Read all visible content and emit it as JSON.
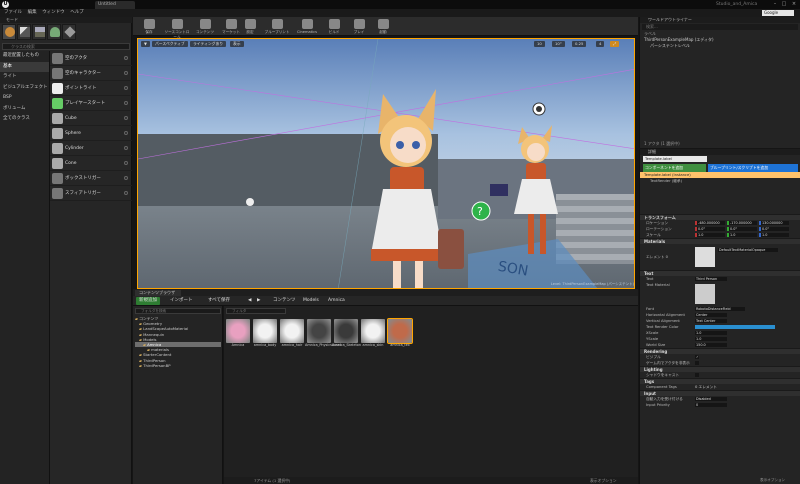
{
  "app": {
    "tab_title": "Untitled",
    "project_name": "Studio_and_Amica",
    "search_provider": "Google"
  },
  "menu": [
    "ファイル",
    "編集",
    "ウィンドウ",
    "ヘルプ"
  ],
  "modes": {
    "header": "モード",
    "search_placeholder": "クラスの検索",
    "categories": [
      "最近配置したもの",
      "基本",
      "ライト",
      "ビジュアルエフェクト",
      "BSP",
      "ボリューム",
      "全てのクラス"
    ],
    "selected_category": "基本",
    "assets": [
      "空のアクタ",
      "空のキャラクター",
      "ポイントライト",
      "プレイヤースタート",
      "Cube",
      "Sphere",
      "Cylinder",
      "Cone",
      "ボックストリガー",
      "スフィアトリガー"
    ]
  },
  "toolbar": [
    "保存",
    "ソースコントロール",
    "コンテンツ",
    "マーケット",
    "設定",
    "ブループリント",
    "Cinematics",
    "ビルド",
    "プレイ",
    "起動"
  ],
  "viewport": {
    "perspective_label": "パースペクティブ",
    "lit_label": "ライティングあり",
    "show_label": "表示",
    "level_label": "Level: ThirdPersonExampleMap (パーシステント)",
    "grid_snap": "10",
    "rotation_snap": "10°",
    "scale_snap": "0.25",
    "camera_speed": "4"
  },
  "content_browser": {
    "tab": "コンテンツブラウザ",
    "add_new": "新規追加",
    "import": "インポート",
    "save_all": "すべて保存",
    "path": [
      "コンテンツ",
      "Models",
      "Amnica"
    ],
    "search_folders_placeholder": "フォルダを検索",
    "filter_placeholder": "フィルタ",
    "tree": [
      {
        "label": "コンテンツ",
        "depth": 0
      },
      {
        "label": "Geometry",
        "depth": 1
      },
      {
        "label": "LandScapeAutoMaterial",
        "depth": 1
      },
      {
        "label": "Mannequin",
        "depth": 1
      },
      {
        "label": "Models",
        "depth": 1
      },
      {
        "label": "Amnica",
        "depth": 2
      },
      {
        "label": "materials",
        "depth": 3
      },
      {
        "label": "StarterContent",
        "depth": 1
      },
      {
        "label": "ThirdPerson",
        "depth": 1
      },
      {
        "label": "ThirdPersonBP",
        "depth": 1
      }
    ],
    "selected_tree_item": "Amnica",
    "assets": [
      "Amnica",
      "amnica_body",
      "amnica_hair",
      "Amnica_PhysicsAsset",
      "Amnica_Skeleton",
      "amnica_skin",
      "amnica_tex"
    ],
    "footer": "7アイテム (1 選択中)",
    "view_options": "表示オプション"
  },
  "outliner": {
    "tab": "ワールドアウトライナー",
    "search_placeholder": "検索...",
    "label_col": "ラベル",
    "type_col": "種類",
    "row1": "ThirdPersonExampleMap (エディタ)",
    "row2": "パーシステントレベル",
    "footer": "1 アクタ (1 選択中)"
  },
  "details": {
    "tab": "詳細",
    "tab2": "ワールドセッティング",
    "actor_name": "Template.label",
    "component_add": "コンポーネントを追加",
    "blueprint_add": "ブループリント/スクリプトを追加",
    "instance": "Template.label (Instance)",
    "text_render": "TextRender (継承)",
    "sections": {
      "transform": "トランスフォーム",
      "materials": "Materials",
      "text": "Text",
      "rendering": "Rendering",
      "lighting": "Lighting",
      "tags": "Tags",
      "input": "Input"
    },
    "location_label": "ロケーション",
    "location": [
      "-480.000000",
      "-170.000000",
      "130.000000"
    ],
    "rotation_label": "ローテーション",
    "rotation": [
      "0.0°",
      "0.0°",
      "0.0°"
    ],
    "scale_label": "スケール",
    "scale": [
      "1.0",
      "1.0",
      "1.0"
    ],
    "element_label": "エレメント 0",
    "material_value": "DefaultTextMaterialOpaque",
    "text_label": "Text",
    "text_value": "Third Person",
    "text_material_label": "Text Material",
    "font_label": "Font",
    "font_value": "RobotoDistanceField",
    "h_align_label": "Horizontal Alignment",
    "h_align_value": "Center",
    "v_align_label": "Vertical Alignment",
    "v_align_value": "Text Center",
    "color_label": "Text Render Color",
    "world_size_label": "World Size",
    "world_size_value": "150.0",
    "x_scale_label": "XScale",
    "y_scale_label": "YScale",
    "x_scale_value": "1.0",
    "y_scale_value": "1.0",
    "visible_label": "ビジブル",
    "hidden_label": "ゲーム内でアクタを非表示",
    "shadow_label": "シャドウをキャスト",
    "tags_label": "Component Tags",
    "tags_value": "0 エレメント",
    "input_label": "自動入力を受け付ける",
    "input_value": "Disabled",
    "priority_label": "Input Priority",
    "priority_value": "0",
    "view_options": "表示オプション"
  },
  "colors": {
    "accent_orange": "#ffa500",
    "add_green": "#4caf50",
    "blueprint_blue": "#1e73d6",
    "selection_blue": "#2a72c9"
  }
}
